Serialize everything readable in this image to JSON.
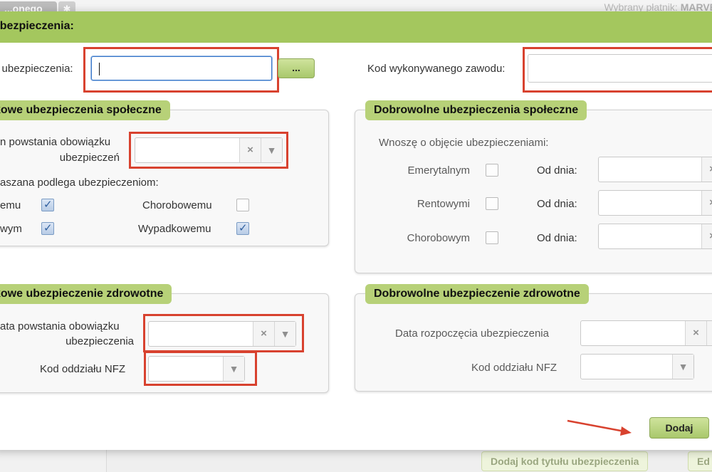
{
  "background": {
    "tab_label": "...onego",
    "tab_button_icon": "star-icon",
    "payer_label": "Wybrany płatnik:",
    "payer_value": "MARVE",
    "footer_buttons": [
      "Dodaj kod tytułu ubezpieczenia",
      "Ed"
    ]
  },
  "dialog": {
    "title": "ubezpieczenia:",
    "insurance_code": {
      "label": "n ubezpieczenia:",
      "value": "",
      "browse_button": "..."
    },
    "occupation_code": {
      "label": "Kod wykonywanego zawodu:",
      "value": ""
    },
    "mandatory_social": {
      "legend": "kowe ubezpieczenia społeczne",
      "date_label_line1": "n powstania obowiązku",
      "date_label_line2": "ubezpieczeń",
      "date_value": "",
      "subject_text": "aszana podlega ubezpieczeniom:",
      "checkboxes": [
        {
          "label": "emu",
          "checked": true
        },
        {
          "label": "Chorobowemu",
          "checked": false
        },
        {
          "label": "wym",
          "checked": true
        },
        {
          "label": "Wypadkowemu",
          "checked": true
        }
      ]
    },
    "voluntary_social": {
      "legend": "Dobrowolne ubezpieczenia społeczne",
      "intro": "Wnoszę o objęcie ubezpieczeniami:",
      "rows": [
        {
          "label": "Emerytalnym",
          "checked": false,
          "date_label": "Od dnia:",
          "date_value": ""
        },
        {
          "label": "Rentowymi",
          "checked": false,
          "date_label": "Od dnia:",
          "date_value": ""
        },
        {
          "label": "Chorobowym",
          "checked": false,
          "date_label": "Od dnia:",
          "date_value": ""
        }
      ]
    },
    "mandatory_health": {
      "legend": "kowe ubezpieczenie zdrowotne",
      "date_label_line1": "ata powstania obowiązku",
      "date_label_line2": "ubezpieczenia",
      "date_value": "",
      "nfz_label": "Kod oddziału NFZ",
      "nfz_value": ""
    },
    "voluntary_health": {
      "legend": "Dobrowolne ubezpieczenie zdrowotne",
      "start_label": "Data rozpoczęcia ubezpieczenia",
      "start_value": "",
      "nfz_label": "Kod oddziału NFZ",
      "nfz_value": ""
    },
    "add_button": "Dodaj"
  },
  "icons": {
    "clear": "×",
    "dropdown": "▼"
  },
  "colors": {
    "header_green": "#a4c75e",
    "legend_green": "#b7d178",
    "highlight_red": "#d8422f",
    "focus_blue": "#3a78c9"
  }
}
